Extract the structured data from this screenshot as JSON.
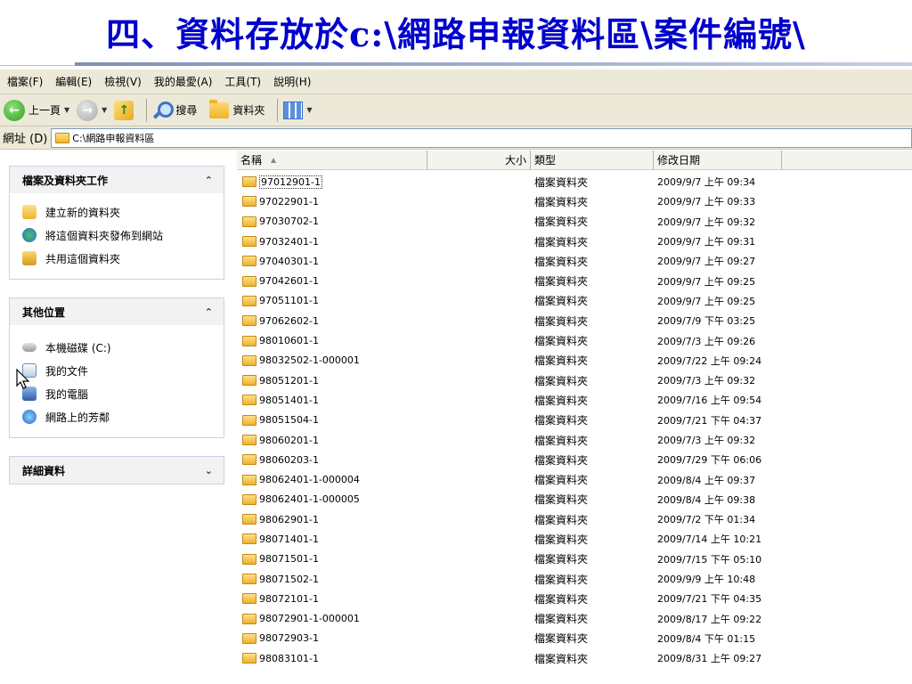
{
  "slide": {
    "title": "四、資料存放於c:\\網路申報資料區\\案件編號\\"
  },
  "menubar": [
    "檔案(F)",
    "編輯(E)",
    "檢視(V)",
    "我的最愛(A)",
    "工具(T)",
    "說明(H)"
  ],
  "toolbar": {
    "back_label": "上一頁",
    "search_label": "搜尋",
    "folders_label": "資料夾"
  },
  "address": {
    "label": "網址 (D)",
    "value": "C:\\網路申報資料區"
  },
  "taskpane": {
    "file_tasks": {
      "title": "檔案及資料夾工作",
      "items": [
        "建立新的資料夾",
        "將這個資料夾發佈到網站",
        "共用這個資料夾"
      ]
    },
    "other_places": {
      "title": "其他位置",
      "items": [
        "本機磁碟 (C:)",
        "我的文件",
        "我的電腦",
        "網路上的芳鄰"
      ]
    },
    "details": {
      "title": "詳細資料"
    }
  },
  "columns": {
    "name": "名稱",
    "size": "大小",
    "type": "類型",
    "modified": "修改日期"
  },
  "files": [
    {
      "name": "97012901-1",
      "type": "檔案資料夾",
      "date": "2009/9/7 上午 09:34"
    },
    {
      "name": "97022901-1",
      "type": "檔案資料夾",
      "date": "2009/9/7 上午 09:33"
    },
    {
      "name": "97030702-1",
      "type": "檔案資料夾",
      "date": "2009/9/7 上午 09:32"
    },
    {
      "name": "97032401-1",
      "type": "檔案資料夾",
      "date": "2009/9/7 上午 09:31"
    },
    {
      "name": "97040301-1",
      "type": "檔案資料夾",
      "date": "2009/9/7 上午 09:27"
    },
    {
      "name": "97042601-1",
      "type": "檔案資料夾",
      "date": "2009/9/7 上午 09:25"
    },
    {
      "name": "97051101-1",
      "type": "檔案資料夾",
      "date": "2009/9/7 上午 09:25"
    },
    {
      "name": "97062602-1",
      "type": "檔案資料夾",
      "date": "2009/7/9 下午 03:25"
    },
    {
      "name": "98010601-1",
      "type": "檔案資料夾",
      "date": "2009/7/3 上午 09:26"
    },
    {
      "name": "98032502-1-000001",
      "type": "檔案資料夾",
      "date": "2009/7/22 上午 09:24"
    },
    {
      "name": "98051201-1",
      "type": "檔案資料夾",
      "date": "2009/7/3 上午 09:32"
    },
    {
      "name": "98051401-1",
      "type": "檔案資料夾",
      "date": "2009/7/16 上午 09:54"
    },
    {
      "name": "98051504-1",
      "type": "檔案資料夾",
      "date": "2009/7/21 下午 04:37"
    },
    {
      "name": "98060201-1",
      "type": "檔案資料夾",
      "date": "2009/7/3 上午 09:32"
    },
    {
      "name": "98060203-1",
      "type": "檔案資料夾",
      "date": "2009/7/29 下午 06:06"
    },
    {
      "name": "98062401-1-000004",
      "type": "檔案資料夾",
      "date": "2009/8/4 上午 09:37"
    },
    {
      "name": "98062401-1-000005",
      "type": "檔案資料夾",
      "date": "2009/8/4 上午 09:38"
    },
    {
      "name": "98062901-1",
      "type": "檔案資料夾",
      "date": "2009/7/2 下午 01:34"
    },
    {
      "name": "98071401-1",
      "type": "檔案資料夾",
      "date": "2009/7/14 上午 10:21"
    },
    {
      "name": "98071501-1",
      "type": "檔案資料夾",
      "date": "2009/7/15 下午 05:10"
    },
    {
      "name": "98071502-1",
      "type": "檔案資料夾",
      "date": "2009/9/9 上午 10:48"
    },
    {
      "name": "98072101-1",
      "type": "檔案資料夾",
      "date": "2009/7/21 下午 04:35"
    },
    {
      "name": "98072901-1-000001",
      "type": "檔案資料夾",
      "date": "2009/8/17 上午 09:22"
    },
    {
      "name": "98072903-1",
      "type": "檔案資料夾",
      "date": "2009/8/4 下午 01:15"
    },
    {
      "name": "98083101-1",
      "type": "檔案資料夾",
      "date": "2009/8/31 上午 09:27"
    }
  ],
  "colors": {
    "title_text": "#0000cc",
    "chrome": "#ece9d8",
    "folder": "#f0b429"
  },
  "icons": {
    "back": "green-back-arrow-icon",
    "forward": "gray-forward-arrow-icon",
    "up": "up-folder-icon",
    "search": "magnifier-icon",
    "folders": "folder-icon",
    "views": "views-grid-icon",
    "cursor": "mouse-pointer-icon"
  }
}
